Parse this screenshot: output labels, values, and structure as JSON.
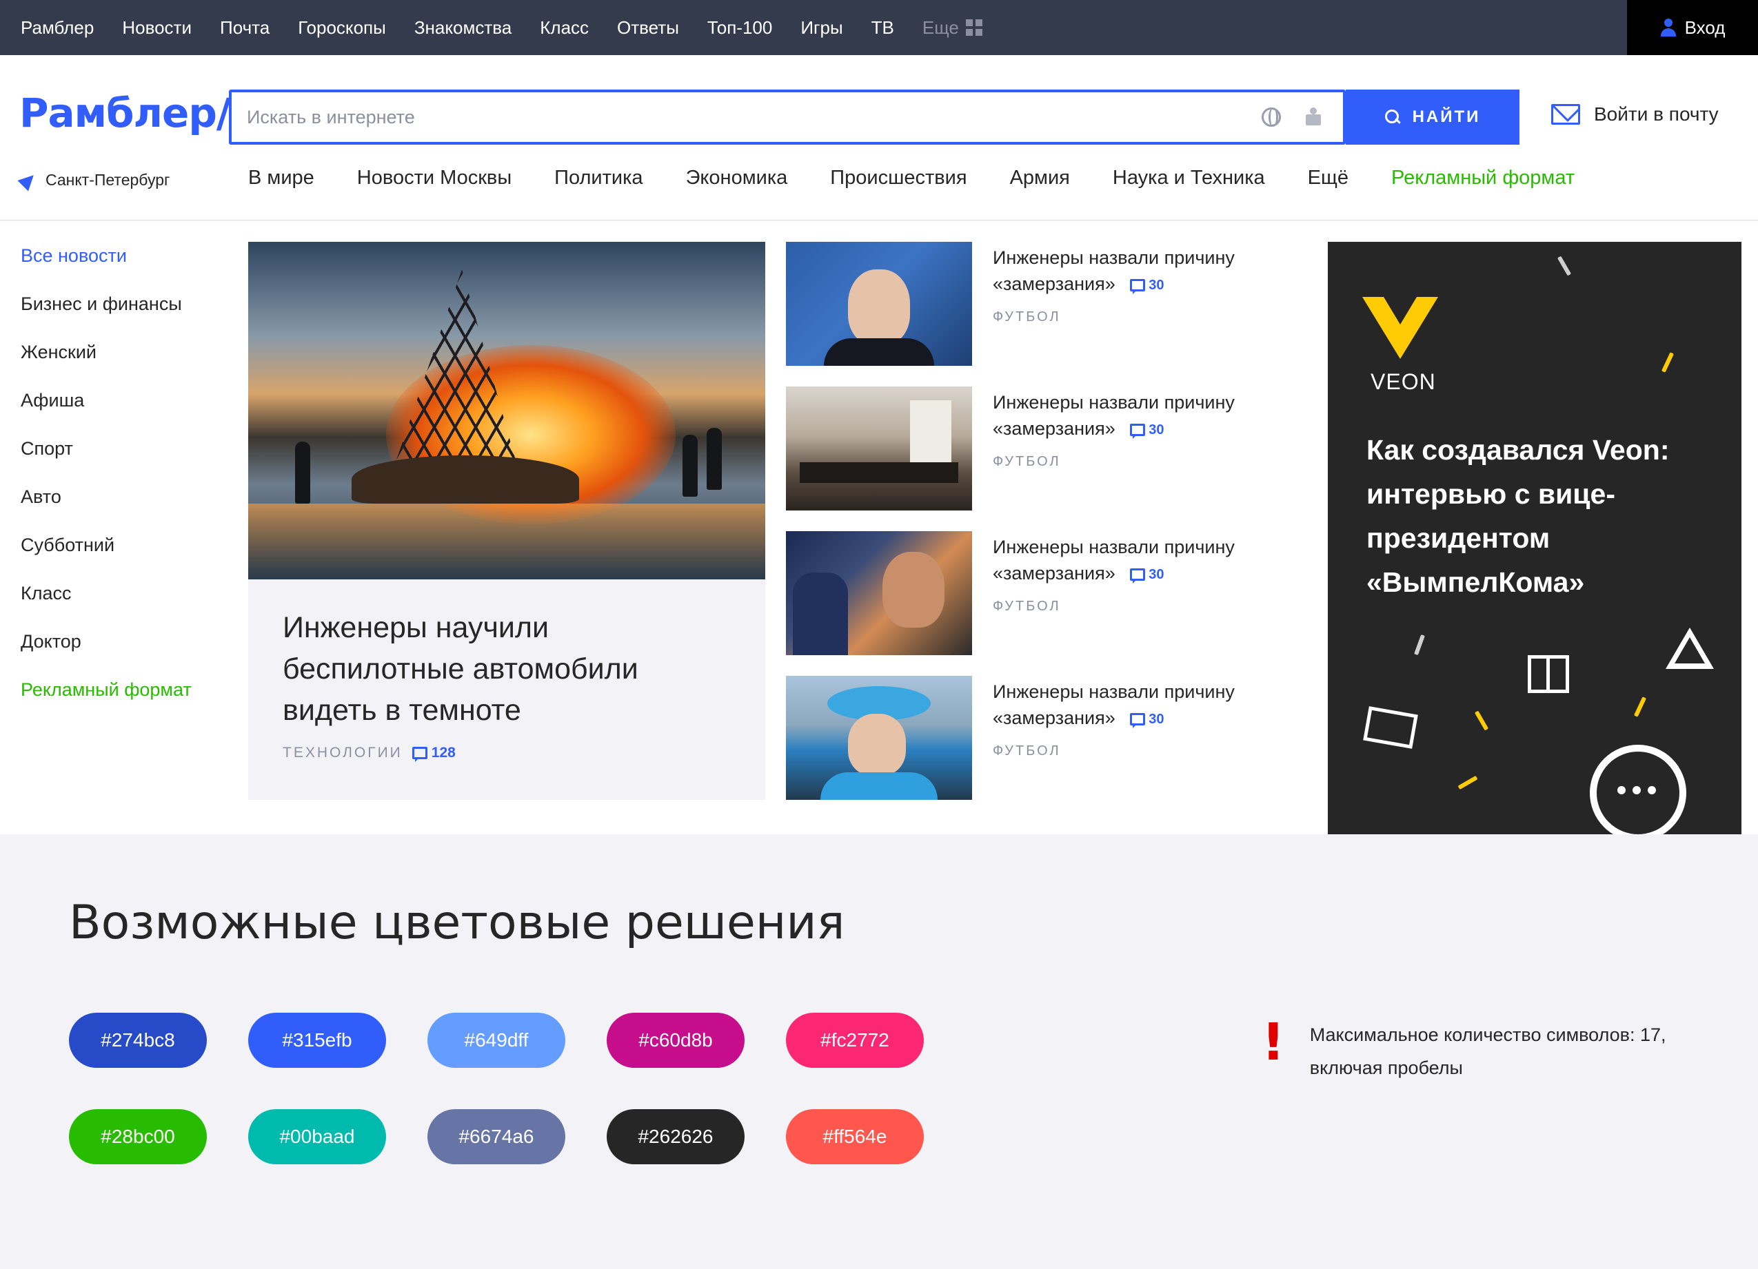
{
  "topbar": {
    "links": [
      "Рамблер",
      "Новости",
      "Почта",
      "Гороскопы",
      "Знакомства",
      "Класс",
      "Ответы",
      "Топ-100",
      "Игры",
      "ТВ"
    ],
    "more_label": "Еще",
    "login_label": "Вход"
  },
  "header": {
    "logo": "Рамблер/",
    "search_placeholder": "Искать в интернете",
    "search_button": "НАЙТИ",
    "mail_link": "Войти в почту",
    "city": "Санкт-Петербург",
    "nav": [
      "В мире",
      "Новости Москвы",
      "Политика",
      "Экономика",
      "Происшествия",
      "Армия",
      "Наука и Техника",
      "Ещё"
    ],
    "nav_promo": "Рекламный формат"
  },
  "sidebar": {
    "active": "Все новости",
    "items": [
      "Бизнес и финансы",
      "Женский",
      "Афиша",
      "Спорт",
      "Авто",
      "Субботний",
      "Класс",
      "Доктор"
    ],
    "promo": "Рекламный формат"
  },
  "main_story": {
    "title": "Инженеры научили беспилотные автомобили видеть в темноте",
    "tag": "ТЕХНОЛОГИИ",
    "comments": "128"
  },
  "news": [
    {
      "title": "Инженеры назвали причину «замерзания»",
      "comments": "30",
      "tag": "ФУТБОЛ"
    },
    {
      "title": "Инженеры назвали причину «замерзания»",
      "comments": "30",
      "tag": "ФУТБОЛ"
    },
    {
      "title": "Инженеры назвали причину «замерзания»",
      "comments": "30",
      "tag": "ФУТБОЛ"
    },
    {
      "title": "Инженеры назвали причину «замерзания»",
      "comments": "30",
      "tag": "ФУТБОЛ"
    }
  ],
  "ad": {
    "brand": "VEON",
    "title": "Как создавался Veon: интервью с вице-президентом «ВымпелКома»",
    "brand_color": "#ffcb05"
  },
  "colors": {
    "title": "Возможные цветовые решения",
    "swatches": [
      "#274bc8",
      "#315efb",
      "#649dff",
      "#c60d8b",
      "#fc2772",
      "#28bc00",
      "#00baad",
      "#6674a6",
      "#262626",
      "#ff564e"
    ],
    "note": "Максимальное количество символов: 17, включая пробелы"
  },
  "theme": {
    "accent": "#315efb",
    "promo": "#28bc00",
    "topbar": "#343b4c"
  }
}
